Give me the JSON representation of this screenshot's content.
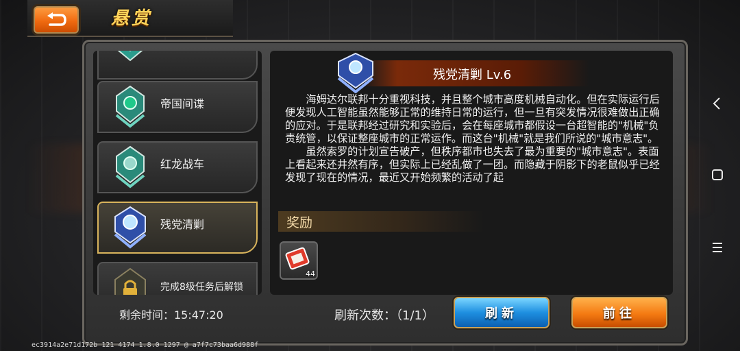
{
  "header": {
    "title": "悬赏",
    "back_icon": "back-arrow-icon"
  },
  "tasks": [
    {
      "label": "",
      "icon": "bounty-badge-icon",
      "active": false,
      "locked": false
    },
    {
      "label": "帝国间谍",
      "icon": "bounty-badge-icon",
      "active": false,
      "locked": false
    },
    {
      "label": "红龙战车",
      "icon": "bounty-badge-icon",
      "active": false,
      "locked": false
    },
    {
      "label": "残党清剿",
      "icon": "bounty-badge-icon",
      "active": true,
      "locked": false
    },
    {
      "label": "完成8级任务后解锁",
      "icon": "lock-icon",
      "active": false,
      "locked": true
    }
  ],
  "remaining_time": "剩余时间：15:47:20",
  "mission": {
    "title": "残党清剿 Lv.6",
    "description": "　　海姆达尔联邦十分重视科技，并且整个城市高度机械自动化。但在实际运行后便发现人工智能虽然能够正常的维持日常的运行，但一旦有突发情况很难做出正确的应对。于是联邦经过研究和实验后，会在每座城市都假设一台超智能的\"机械\"负责统管，以保证整座城市的正常运作。而这台\"机械\"就是我们所说的\"城市意志\"。\n　　虽然索罗的计划宣告破产，但秩序都市也失去了最为重要的\"城市意志\"。表面上看起来还井然有序，但实际上已经乱做了一团。而隐藏于阴影下的老鼠似乎已经发现了现在的情况，最近又开始频繁的活动了起"
  },
  "reward": {
    "title": "奖励",
    "item": {
      "icon": "scroll-ticket-icon",
      "count": "44"
    }
  },
  "refresh_count": "刷新次数：（1/1）",
  "buttons": {
    "refresh": "刷新",
    "go": "前往"
  },
  "build_info": "ec3914a2e71d172b 121 4174 1.8.0 1297 @ a7f7c73baa6d988f",
  "colors": {
    "accent_orange": "#f47a12",
    "accent_blue": "#1e8fe0",
    "gold": "#d9b45c"
  }
}
